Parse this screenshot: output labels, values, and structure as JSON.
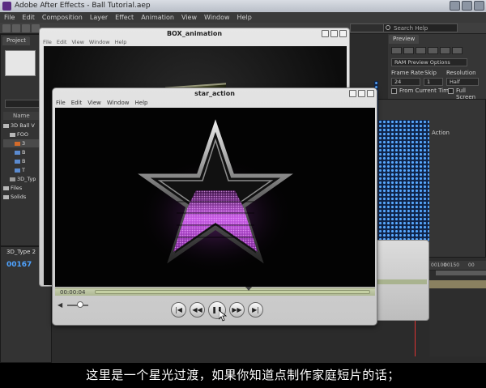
{
  "app": {
    "title": "Adobe After Effects - Ball Tutorial.aep",
    "menu": [
      "File",
      "Edit",
      "Composition",
      "Layer",
      "Effect",
      "Animation",
      "View",
      "Window",
      "Help"
    ],
    "search_placeholder": "Search Help"
  },
  "project": {
    "tab": "Project",
    "column_name": "Name",
    "items": [
      "3D Ball V",
      "FOO",
      "3",
      "B",
      "B",
      "T",
      "3D_Typ",
      "Files",
      "Solids"
    ]
  },
  "timeline": {
    "tab": "3D_Type 2",
    "timecode": "00167",
    "ruler_ticks": [
      "00100",
      "00150",
      "00"
    ]
  },
  "preview": {
    "tab": "Preview",
    "ram_option": "RAM Preview Options",
    "frame_rate_label": "Frame Rate",
    "skip_label": "Skip",
    "resolution_label": "Resolution",
    "frame_rate": "24",
    "skip": "1",
    "resolution": "Half",
    "from_current_time": "From Current Time",
    "full_screen": "Full Screen"
  },
  "effects_panel": {
    "action_label": "Action"
  },
  "box_window": {
    "title": "BOX_animation",
    "menu": [
      "File",
      "Edit",
      "View",
      "Window",
      "Help"
    ]
  },
  "star_window": {
    "title": "star_action",
    "menu": [
      "File",
      "Edit",
      "View",
      "Window",
      "Help"
    ],
    "current_time": "00:00:04",
    "playhead_fraction": 0.56,
    "volume_fraction": 0.45
  },
  "subtitle": "这里是一个星光过渡，如果你知道点制作家庭短片的话；"
}
